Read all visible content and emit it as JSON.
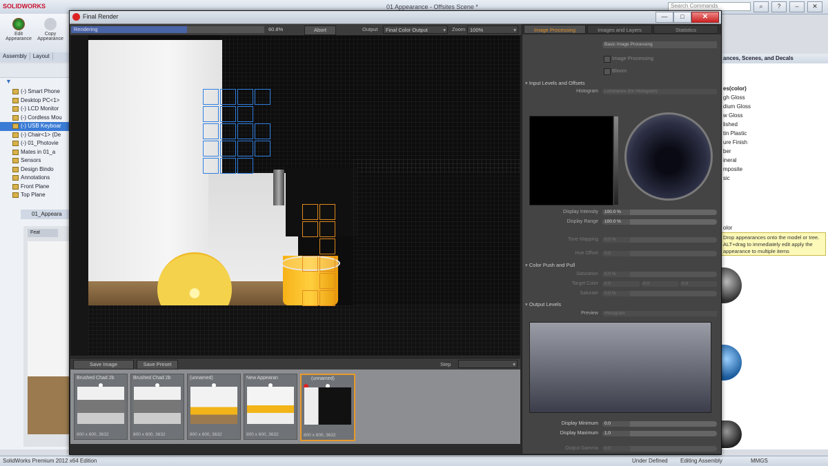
{
  "app": {
    "title": "01 Appearance - Offsites Scene *",
    "logo": "SOLIDWORKS",
    "search_placeholder": "Search Commands",
    "status": {
      "edition": "SolidWorks Premium 2012 x64 Edition",
      "defined": "Under Defined",
      "editing": "Editing Assembly",
      "units": "MMGS"
    }
  },
  "ribbon": {
    "edit_appearance": "Edit Appearance",
    "copy_appearance": "Copy Appearance",
    "tabs": [
      "Assembly",
      "Layout"
    ]
  },
  "tree": {
    "items": [
      {
        "label": "(-) Smart Phone",
        "selected": false
      },
      {
        "label": "Desktop PC<1>",
        "selected": false
      },
      {
        "label": "(-) LCD Monitor",
        "selected": false
      },
      {
        "label": "(-) Cordless Mou",
        "selected": false
      },
      {
        "label": "(-) USB Keyboar",
        "selected": true
      },
      {
        "label": "(-) Chair<1> (De",
        "selected": false
      },
      {
        "label": "(-) 01_Photovie",
        "selected": false
      },
      {
        "label": "Mates in 01_a",
        "selected": false
      },
      {
        "label": "Sensors",
        "selected": false
      },
      {
        "label": "Design Bindo",
        "selected": false
      },
      {
        "label": "Annotations",
        "selected": false
      },
      {
        "label": "Front Plane",
        "selected": false
      },
      {
        "label": "Top Plane",
        "selected": false
      }
    ],
    "subwindow_title": "01_Appeara",
    "subwindow_tab": "Feat"
  },
  "right_pane": {
    "header": "ances, Scenes, and Decals",
    "color_label": "es(color)",
    "items": [
      "gh Gloss",
      "dium Gloss",
      "w Gloss",
      "lished",
      "tin Plastic",
      "ure Finish",
      "ber",
      "ineral",
      "mposite",
      "sic"
    ],
    "tooltip": "Drop appearances onto the model or tree. ALT+drag to immediately edit apply the appearance to multiple items",
    "section2": "olor"
  },
  "render_window": {
    "title": "Final Render",
    "minimize": "—",
    "maximize": "□",
    "close": "✕",
    "toolbar": {
      "status": "Rendering",
      "percent": "60.8%",
      "abort": "Abort",
      "output_label": "Output",
      "output_value": "Final Color Output",
      "zoom_label": "Zoom",
      "zoom_value": "100%"
    },
    "strip_bar": {
      "save_image": "Save Image",
      "save_preset": "Save Preset",
      "step_label": "Step"
    },
    "thumbs": [
      {
        "title": "Brushed Chad 2b",
        "size": "800 x 600, 3632"
      },
      {
        "title": "Brushed Chad 2b",
        "size": "800 x 600, 3632"
      },
      {
        "title": "(unnamed)",
        "size": "800 x 600, 3632"
      },
      {
        "title": "New Appearan",
        "size": "800 x 600, 3632"
      },
      {
        "title": "(unnamed)",
        "size": "800 x 600, 3632"
      }
    ],
    "progress_fraction": 0.6
  },
  "panel": {
    "tabs": [
      "Image Processing",
      "Images and Layers",
      "Statistics"
    ],
    "basic_label": "Basic Image Processing",
    "image_processing_label": "Image Processing",
    "bloom_label": "Bloom",
    "sections": {
      "input": "Input Levels and Offsets",
      "color": "Color Push and Pull",
      "output": "Output Levels"
    },
    "histogram_label": "Histogram",
    "histogram_value": "Luminance (for Histogram)",
    "display_intensity_label": "Display Intensity",
    "display_intensity_value": "100.0 %",
    "display_range_label": "Display Range",
    "display_range_value": "100.0 %",
    "tone_mapping_label": "Tone Mapping",
    "tone_mapping_value": "0.0 %",
    "hue_offset_label": "Hue Offset",
    "hue_offset_value": "0.0",
    "saturation_label": "Saturation",
    "saturation_value": "0.0 %",
    "target_color_label": "Target Color",
    "target_color_values": [
      "0.0",
      "0.0",
      "0.0"
    ],
    "saturate_label": "Saturate",
    "saturate_value": "0.0 %",
    "preview_label": "Preview",
    "preview_value": "Histogram",
    "display_minimum_label": "Display Minimum",
    "display_minimum_value": "0.0",
    "display_maximum_label": "Display Maximum",
    "display_maximum_value": "1.0",
    "output_gamma_label": "Output Gamma",
    "output_gamma_value": "0.0"
  }
}
